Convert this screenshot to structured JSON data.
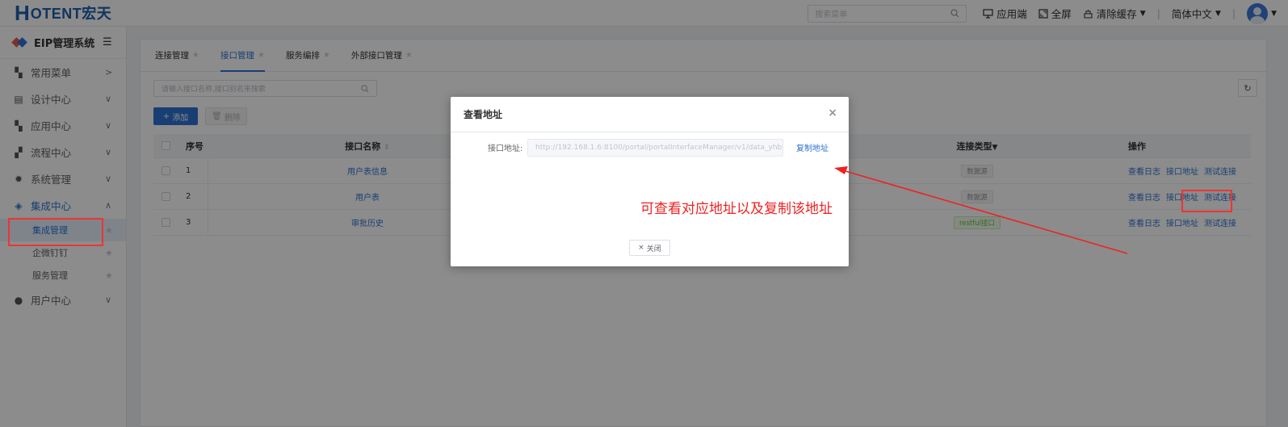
{
  "brand": {
    "logo_letter": "H",
    "logo_text": "OTENT宏天"
  },
  "topbar": {
    "search_placeholder": "搜索菜单",
    "app_label": "应用端",
    "fullscreen_label": "全屏",
    "clear_cache_label": "清除缓存",
    "language_label": "简体中文"
  },
  "sidebar": {
    "system_title": "EIP管理系统",
    "items": [
      {
        "label": "常用菜单",
        "icon": "grid-icon"
      },
      {
        "label": "设计中心",
        "icon": "design-icon"
      },
      {
        "label": "应用中心",
        "icon": "apps-icon"
      },
      {
        "label": "流程中心",
        "icon": "flow-icon"
      },
      {
        "label": "系统管理",
        "icon": "gear-icon"
      },
      {
        "label": "集成中心",
        "icon": "layers-icon"
      }
    ],
    "sub_items": [
      {
        "label": "集成管理"
      },
      {
        "label": "企微钉钉"
      },
      {
        "label": "服务管理"
      }
    ],
    "user_center": {
      "label": "用户中心",
      "icon": "user-icon"
    }
  },
  "tabs": [
    {
      "label": "连接管理"
    },
    {
      "label": "接口管理"
    },
    {
      "label": "服务编排"
    },
    {
      "label": "外部接口管理"
    }
  ],
  "toolbar": {
    "search_placeholder": "请输入接口名称,接口别名来搜索",
    "add_label": "添加",
    "delete_label": "删除"
  },
  "table": {
    "headers": {
      "no": "序号",
      "name": "接口名称",
      "type": "连接类型",
      "ops": "操作"
    },
    "rows": [
      {
        "no": "1",
        "name": "用户表信息",
        "type": "数据源",
        "type_style": "gray"
      },
      {
        "no": "2",
        "name": "用户表",
        "type": "数据源",
        "type_style": "gray"
      },
      {
        "no": "3",
        "name": "审批历史",
        "type": "restful接口",
        "type_style": "green"
      }
    ],
    "ops": {
      "log": "查看日志",
      "address": "接口地址",
      "test": "测试连接"
    }
  },
  "dialog": {
    "title": "查看地址",
    "field_label": "接口地址:",
    "field_value": "http://192.168.1.6:8100/portal/portalInterfaceManager/v1/data_yhb",
    "copy_label": "复制地址",
    "close_label": "关闭",
    "annotation": "可查看对应地址以及复制该地址"
  },
  "colors": {
    "accent": "#2e72d2",
    "annotation": "#ee2222",
    "logo": "#1f5fae"
  }
}
